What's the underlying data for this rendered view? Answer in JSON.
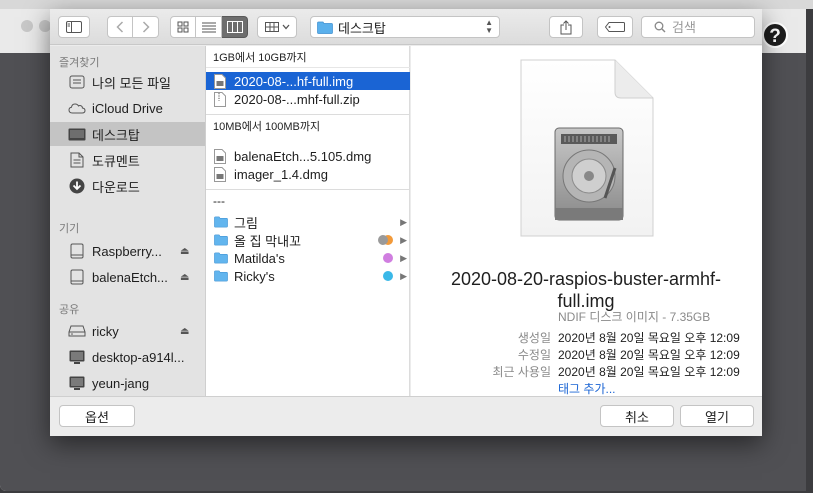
{
  "toolbar": {
    "location": "데스크탑",
    "search_placeholder": "검색"
  },
  "sidebar": {
    "favorites_header": "즐겨찾기",
    "favorites": [
      {
        "label": "나의 모든 파일",
        "icon": "all-files-icon"
      },
      {
        "label": "iCloud Drive",
        "icon": "cloud-icon"
      },
      {
        "label": "데스크탑",
        "icon": "desktop-icon",
        "selected": true
      },
      {
        "label": "도큐멘트",
        "icon": "documents-icon"
      },
      {
        "label": "다운로드",
        "icon": "download-icon"
      }
    ],
    "devices_header": "기기",
    "devices": [
      {
        "label": "Raspberry...",
        "icon": "disk-icon"
      },
      {
        "label": "balenaEtch...",
        "icon": "disk-icon"
      }
    ],
    "shared_header": "공유",
    "shared": [
      {
        "label": "ricky",
        "icon": "server-icon"
      },
      {
        "label": "desktop-a914l...",
        "icon": "display-icon"
      },
      {
        "label": "yeun-jang",
        "icon": "display-icon"
      }
    ]
  },
  "files": {
    "group1_header": "1GB에서 10GB까지",
    "group1": [
      "2020-08-...hf-full.img",
      "2020-08-...mhf-full.zip"
    ],
    "group2_header": "10MB에서 100MB까지",
    "group2": [
      "balenaEtch...5.105.dmg",
      "imager_1.4.dmg"
    ],
    "group3_header": "---",
    "folders": [
      {
        "label": "그림",
        "tag": null
      },
      {
        "label": "올 집 막내꼬",
        "tag": "multi"
      },
      {
        "label": "Matilda's",
        "tag": "#d07ee0"
      },
      {
        "label": "Ricky's",
        "tag": "#3ab8e8"
      }
    ]
  },
  "preview": {
    "name": "2020-08-20-raspios-buster-armhf-full.img",
    "kind": "NDIF 디스크 이미지 - 7.35GB",
    "created_key": "생성일",
    "created_val": "2020년 8월 20일 목요일 오후 12:09",
    "modified_key": "수정일",
    "modified_val": "2020년 8월 20일 목요일 오후 12:09",
    "opened_key": "최근 사용일",
    "opened_val": "2020년 8월 20일 목요일 오후 12:09",
    "add_tags": "태그 추가..."
  },
  "footer": {
    "options": "옵션",
    "cancel": "취소",
    "open": "열기"
  },
  "colors": {
    "accent": "#1a64d4",
    "sidebar_selected": "#c4c4c4"
  }
}
